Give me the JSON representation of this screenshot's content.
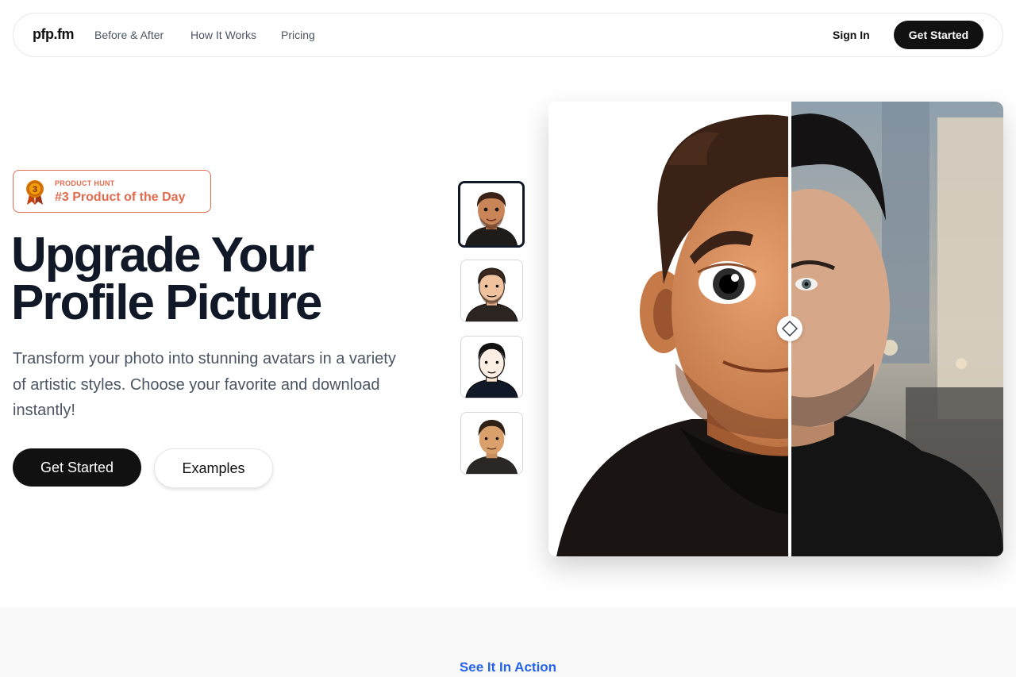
{
  "nav": {
    "logo": "pfp.fm",
    "links": [
      "Before & After",
      "How It Works",
      "Pricing"
    ],
    "sign_in": "Sign In",
    "cta": "Get Started"
  },
  "badge": {
    "kicker": "PRODUCT HUNT",
    "title": "#3 Product of the Day",
    "medal_number": "3",
    "color": "#e26b4f"
  },
  "hero": {
    "headline_line1": "Upgrade Your",
    "headline_line2": "Profile Picture",
    "subheading": "Transform your photo into stunning avatars in a variety of artistic styles. Choose your favorite and download instantly!",
    "primary_cta": "Get Started",
    "secondary_cta": "Examples"
  },
  "styles": {
    "thumbnails": [
      "3d-cartoon-avatar",
      "illustrated-avatar",
      "line-art-avatar",
      "flat-color-avatar"
    ],
    "selected_index": 0
  },
  "comparison": {
    "left": "3d-cartoon-rendering",
    "right": "original-photo",
    "slider_position": 0.53
  },
  "section2": {
    "kicker": "See It In Action"
  },
  "colors": {
    "primary": "#111111",
    "heading": "#111827",
    "body": "#4b5563",
    "link": "#2563eb"
  }
}
